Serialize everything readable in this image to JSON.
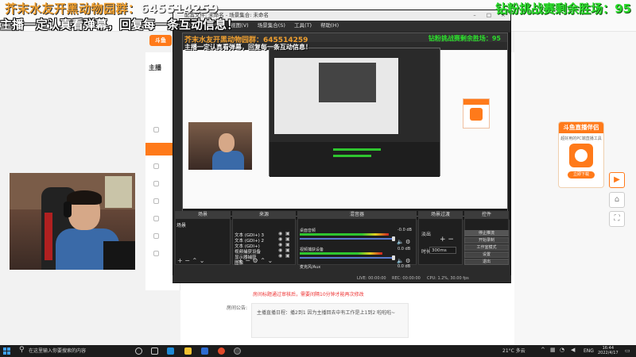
{
  "overlay": {
    "qq_group_label": "芥末水友开黑动物园群：",
    "qq_group_number": "645514259",
    "host_message": "主播一定认真看弹幕，回复每一条互动信息！",
    "drill_challenge": "钻粉挑战赛剩余胜场：95"
  },
  "obs": {
    "title": "配置文件: 未命名 - 场景集合: 未命名",
    "menu": [
      "文件(F)",
      "编辑(E)",
      "视图(V)",
      "场景集合(S)",
      "工具(T)",
      "帮助(H)"
    ],
    "docks": {
      "scenes": "场景",
      "sources": "来源",
      "mixer": "混音器",
      "transitions": "场景过渡",
      "controls": "控件"
    },
    "scene_item": "场景",
    "sources": [
      "文本 (GDI+) 3",
      "文本 (GDI+) 2",
      "文本 (GDI+)",
      "视频捕获设备",
      "显示器捕获",
      "图像"
    ],
    "mixer": [
      {
        "name": "桌面音频",
        "db": "-0.0 dB",
        "active": true
      },
      {
        "name": "视频捕获设备",
        "db": "0.0 dB",
        "active": true
      },
      {
        "name": "麦克风/Aux",
        "db": "0.0 dB",
        "active": false
      }
    ],
    "transition": {
      "type": "淡出",
      "duration_label": "时长",
      "duration": "300ms"
    },
    "controls": [
      "停止推流",
      "开始录制",
      "工作室模式",
      "设置",
      "退出"
    ],
    "status": {
      "live": "LIVE: 00:00:00",
      "rec": "REC: 00:00:00",
      "cpu": "CPU: 1.2%, 30.00 fps"
    }
  },
  "page": {
    "sidebar_title": "主播",
    "notice_label": "房间公告:",
    "notice_text": "主播直播日程：播2到1 因为主播回去中有工作是上1到2 啦啦啦~",
    "warning_text": "房间标题通过审核后，需要间隔10分钟才能再次修改"
  },
  "promo": {
    "title": "斗鱼直播伴侣",
    "subtitle": "超好用的PC端直播工具",
    "button": "立即下载"
  },
  "taskbar": {
    "search_placeholder": "在这里输入你要搜索的内容",
    "temperature": "21°C 多云",
    "language": "ENG",
    "time": "16:44",
    "date": "2022/4/17"
  },
  "colors": {
    "douyu_orange": "#ff7a1a",
    "overlay_gold": "#f0a030",
    "overlay_green": "#2ddc2d",
    "meter_green": "#2fc52f"
  }
}
